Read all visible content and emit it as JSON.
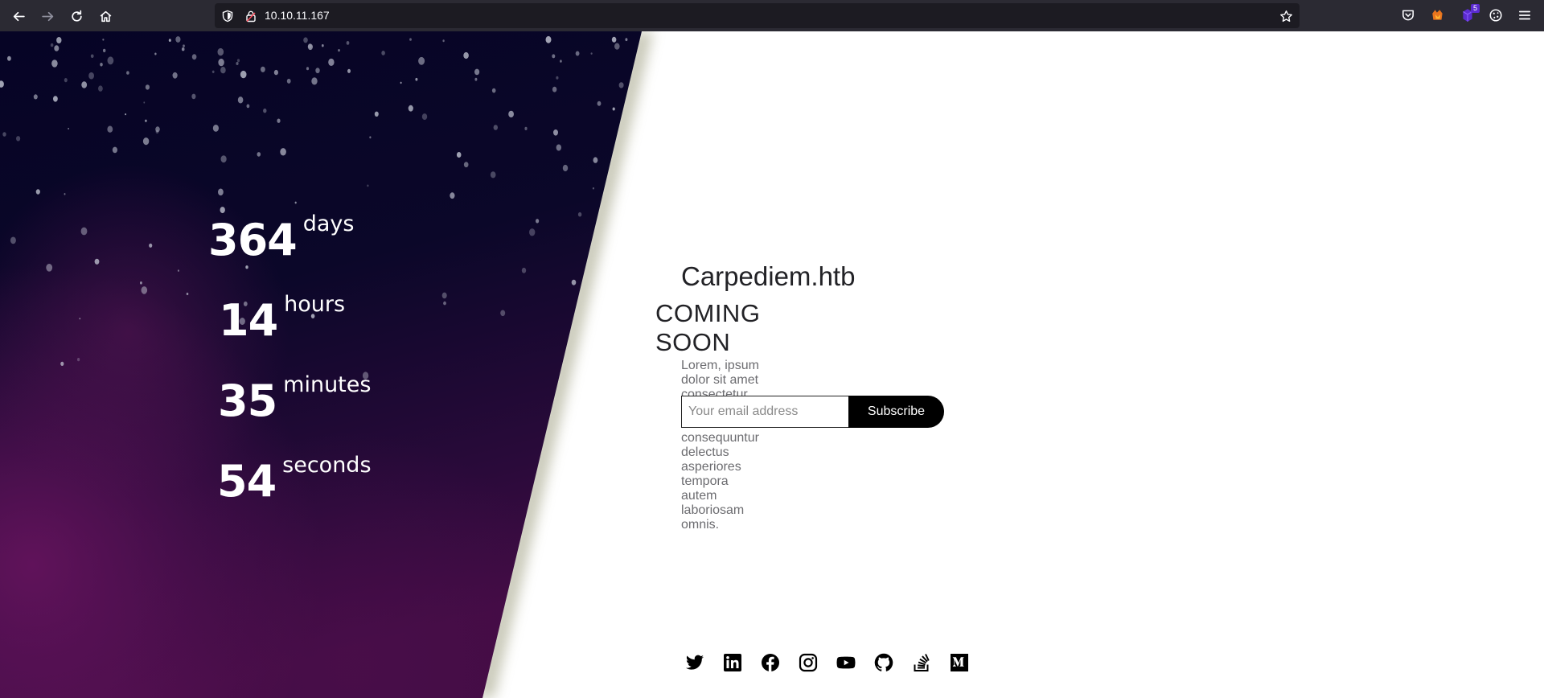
{
  "browser": {
    "url": "10.10.11.167",
    "extension_badge": "5",
    "icons": [
      "back-icon",
      "forward-icon",
      "reload-icon",
      "home-icon",
      "shield-icon",
      "lock-icon",
      "bookmark-star-icon",
      "pocket-icon",
      "firefox-extension-icon",
      "extension-icon",
      "cookie-icon",
      "menu-icon"
    ]
  },
  "countdown": {
    "days": {
      "value": "364",
      "unit": "days"
    },
    "hours": {
      "value": "14",
      "unit": "hours"
    },
    "minutes": {
      "value": "35",
      "unit": "minutes"
    },
    "seconds": {
      "value": "54",
      "unit": "seconds"
    }
  },
  "main": {
    "site_title": "Carpediem.htb",
    "heading": "COMING SOON",
    "description": "Lorem, ipsum dolor sit amet consectetur adipisicing elit. Maxime consequuntur delectus asperiores tempora autem laboriosam omnis.",
    "email_placeholder": "Your email address",
    "subscribe_label": "Subscribe"
  },
  "socials": [
    "twitter-icon",
    "linkedin-icon",
    "facebook-icon",
    "instagram-icon",
    "youtube-icon",
    "github-icon",
    "stackoverflow-icon",
    "medium-icon"
  ],
  "colors": {
    "chrome_bg": "#2b2a33",
    "urlbar_bg": "#1c1b22",
    "hero_dark": "#0a0626",
    "hero_purple": "#4a0f4e",
    "shadow": "#9a9a7a",
    "text_dark": "#222226",
    "text_muted": "#6c6c70",
    "button_bg": "#000000"
  }
}
